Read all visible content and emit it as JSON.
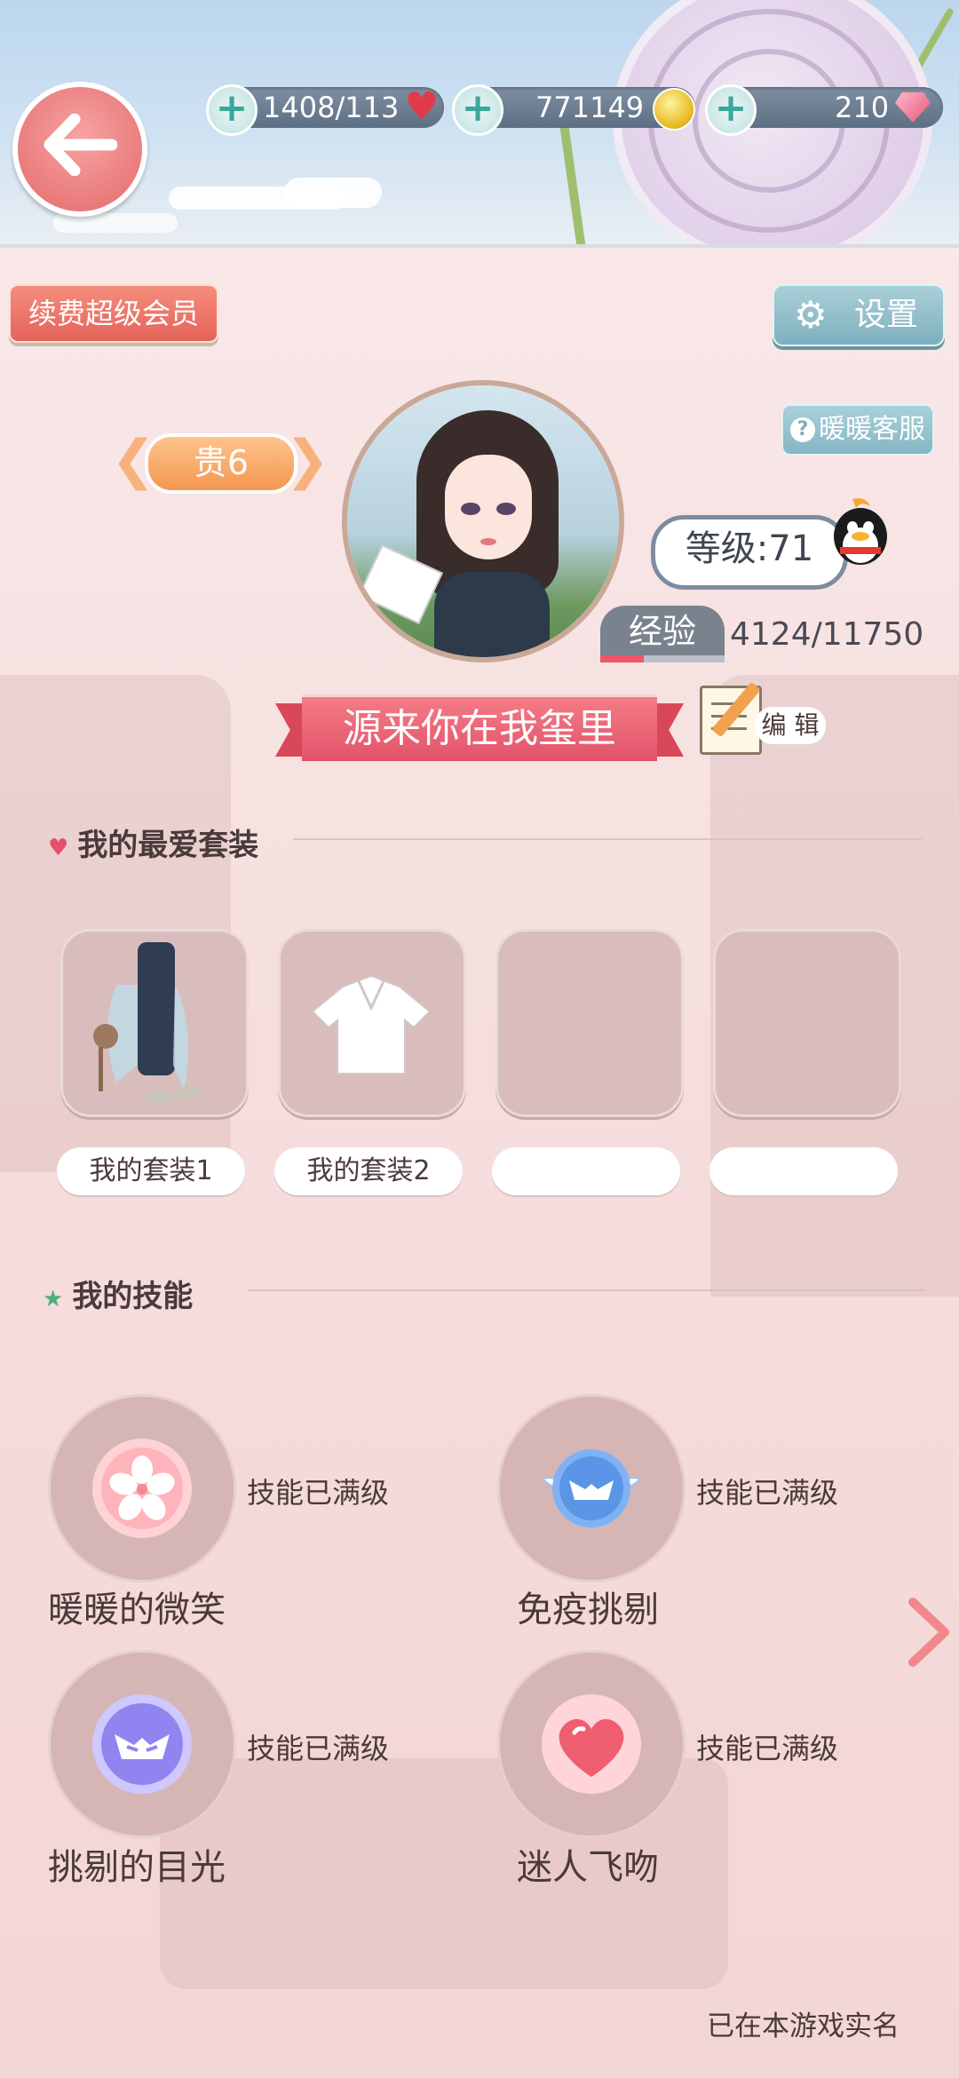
{
  "resources": {
    "stamina": "1408/113",
    "gold": "771149",
    "diamonds": "210"
  },
  "header": {
    "vip_button": "续费超级会员",
    "settings_button": "设置",
    "service_button": "暖暖客服"
  },
  "profile": {
    "rank": "贵6",
    "level": "等级:71",
    "exp_label": "经验",
    "exp_value": "4124/11750",
    "exp_progress": 0.351,
    "nickname": "源来你在我玺里",
    "edit_label": "编 辑"
  },
  "favorites": {
    "title": "我的最爱套装",
    "slots": [
      {
        "label": "我的套装1",
        "has_item": true
      },
      {
        "label": "我的套装2",
        "has_item": true
      },
      {
        "label": "",
        "has_item": false
      },
      {
        "label": "",
        "has_item": false
      }
    ]
  },
  "skills": {
    "title": "我的技能",
    "items": [
      {
        "name": "暖暖的微笑",
        "status": "技能已满级",
        "icon": "sakura-icon"
      },
      {
        "name": "免疫挑剔",
        "status": "技能已满级",
        "icon": "winged-mask-icon"
      },
      {
        "name": "挑剔的目光",
        "status": "技能已满级",
        "icon": "mask-icon"
      },
      {
        "name": "迷人飞吻",
        "status": "技能已满级",
        "icon": "heart-icon"
      }
    ]
  },
  "footer": {
    "realname_note": "已在本游戏实名"
  },
  "colors": {
    "accent": "#e2536a",
    "exp_fill": "#f0566a",
    "settings": "#7eb0bd"
  }
}
